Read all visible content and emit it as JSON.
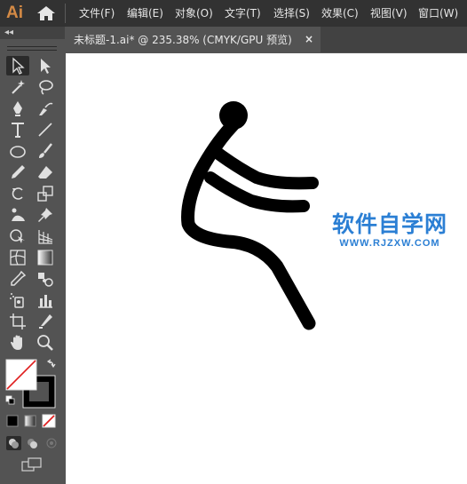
{
  "app": {
    "logo_text": "Ai",
    "menus": [
      "文件(F)",
      "编辑(E)",
      "对象(O)",
      "文字(T)",
      "选择(S)",
      "效果(C)",
      "视图(V)",
      "窗口(W)"
    ]
  },
  "toolbar": {
    "collapse_label": "◂◂",
    "tools": [
      {
        "name": "selection-tool",
        "icon": "arrow-icon"
      },
      {
        "name": "direct-selection-tool",
        "icon": "direct-arrow-icon"
      },
      {
        "name": "magic-wand-tool",
        "icon": "magic-wand-icon"
      },
      {
        "name": "lasso-tool",
        "icon": "lasso-icon"
      },
      {
        "name": "pen-tool",
        "icon": "pen-icon"
      },
      {
        "name": "curvature-tool",
        "icon": "curvature-icon"
      },
      {
        "name": "type-tool",
        "icon": "type-icon"
      },
      {
        "name": "line-tool",
        "icon": "line-icon"
      },
      {
        "name": "ellipse-tool",
        "icon": "ellipse-icon"
      },
      {
        "name": "paintbrush-tool",
        "icon": "brush-icon"
      },
      {
        "name": "pencil-tool",
        "icon": "pencil-icon"
      },
      {
        "name": "eraser-tool",
        "icon": "eraser-icon"
      },
      {
        "name": "rotate-tool",
        "icon": "rotate-icon"
      },
      {
        "name": "scale-tool",
        "icon": "scale-icon"
      },
      {
        "name": "puppet-warp-tool",
        "icon": "puppet-icon"
      },
      {
        "name": "pin-tool",
        "icon": "pin-icon"
      },
      {
        "name": "shape-builder-tool",
        "icon": "shape-builder-icon"
      },
      {
        "name": "perspective-grid-tool",
        "icon": "perspective-icon"
      },
      {
        "name": "mesh-tool",
        "icon": "mesh-icon"
      },
      {
        "name": "gradient-tool",
        "icon": "gradient-icon"
      },
      {
        "name": "eyedropper-tool",
        "icon": "eyedropper-icon"
      },
      {
        "name": "blend-tool",
        "icon": "blend-icon"
      },
      {
        "name": "symbol-sprayer-tool",
        "icon": "sprayer-icon"
      },
      {
        "name": "column-graph-tool",
        "icon": "graph-icon"
      },
      {
        "name": "artboard-tool",
        "icon": "artboard-icon"
      },
      {
        "name": "slice-tool",
        "icon": "slice-icon"
      },
      {
        "name": "hand-tool",
        "icon": "hand-icon"
      },
      {
        "name": "zoom-tool",
        "icon": "zoom-icon"
      }
    ],
    "fill_color": "#ffffff",
    "stroke_color": "#000000"
  },
  "document": {
    "tab_title": "未标题-1.ai* @ 235.38% (CMYK/GPU 预览)",
    "close_glyph": "×"
  },
  "watermark": {
    "title": "软件自学网",
    "url": "WWW.RJZXW.COM"
  },
  "colors": {
    "menubar": "#323232",
    "panel": "#535353",
    "accent": "#d48a45",
    "watermark": "#2b7fd4"
  }
}
